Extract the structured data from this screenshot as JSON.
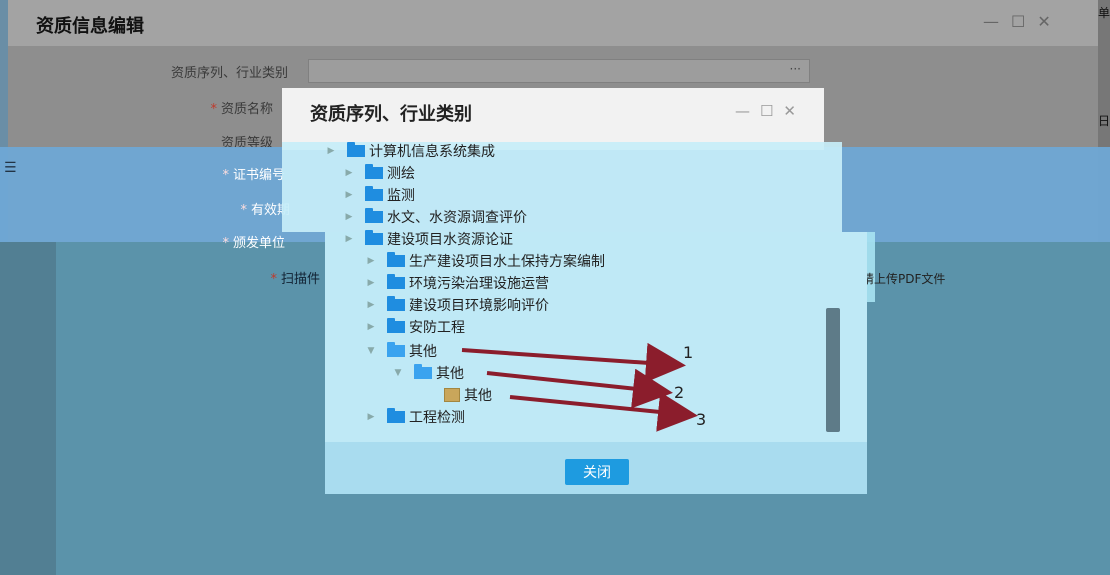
{
  "outer": {
    "title": "资质信息编辑",
    "side_chars": [
      "单",
      "日"
    ],
    "fields": [
      {
        "label": "资质序列、行业类别",
        "required": false,
        "value": "",
        "button": "···"
      },
      {
        "label": "资质名称",
        "required": true
      },
      {
        "label": "资质等级",
        "required": false
      },
      {
        "label": "证书编号",
        "required": true
      },
      {
        "label": "有效期",
        "required": true
      },
      {
        "label": "颁发单位",
        "required": true
      },
      {
        "label": "扫描件",
        "required": true
      }
    ],
    "upload_hint": "请上传PDF文件"
  },
  "dialog": {
    "title": "资质序列、行业类别",
    "close_button": "关闭",
    "tree": [
      {
        "label": "计算机信息系统集成",
        "level": 0,
        "state": "collapsed"
      },
      {
        "label": "测绘",
        "level": 0,
        "state": "collapsed"
      },
      {
        "label": "监测",
        "level": 0,
        "state": "collapsed"
      },
      {
        "label": "水文、水资源调查评价",
        "level": 0,
        "state": "collapsed"
      },
      {
        "label": "建设项目水资源论证",
        "level": 0,
        "state": "collapsed"
      },
      {
        "label": "生产建设项目水土保持方案编制",
        "level": 0,
        "state": "collapsed"
      },
      {
        "label": "环境污染治理设施运营",
        "level": 0,
        "state": "collapsed"
      },
      {
        "label": "建设项目环境影响评价",
        "level": 0,
        "state": "collapsed"
      },
      {
        "label": "安防工程",
        "level": 0,
        "state": "collapsed"
      },
      {
        "label": "其他",
        "level": 0,
        "state": "expanded"
      },
      {
        "label": "其他",
        "level": 1,
        "state": "expanded"
      },
      {
        "label": "其他",
        "level": 2,
        "state": "leaf"
      },
      {
        "label": "工程检测",
        "level": 0,
        "state": "collapsed"
      }
    ]
  },
  "annotations": [
    "1",
    "2",
    "3"
  ],
  "colors": {
    "arrow": "#8b1d2c",
    "button": "#1e9be0",
    "folder": "#1f8de0"
  }
}
